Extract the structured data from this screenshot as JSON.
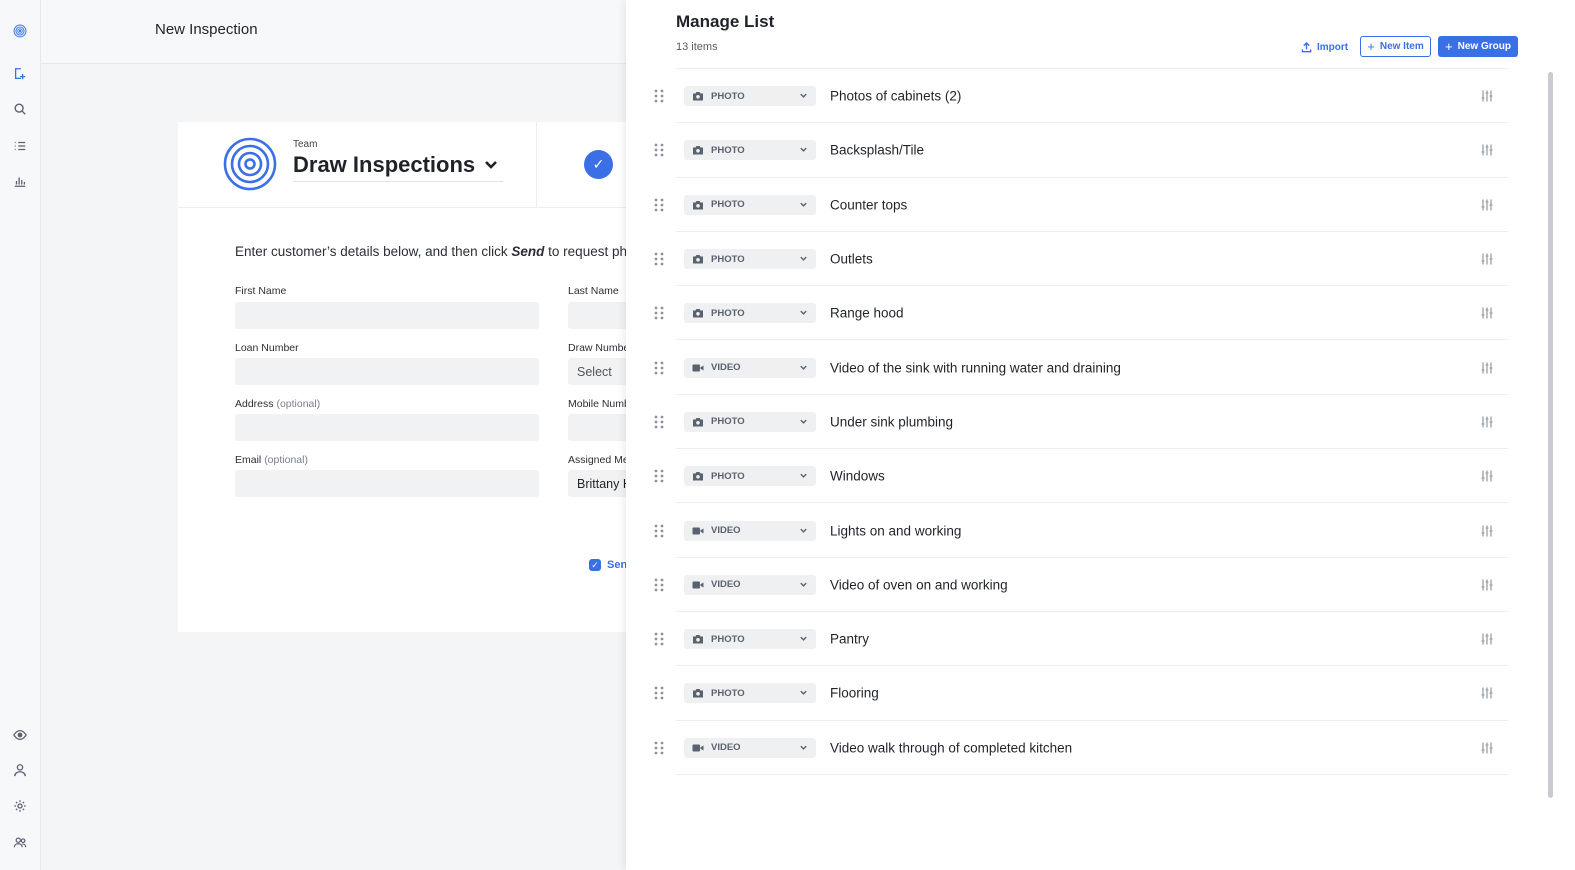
{
  "rail": {
    "icons": [
      "app-logo-icon",
      "new-inspection-icon",
      "search-icon",
      "list-icon",
      "chart-icon",
      "eye-icon",
      "user-icon",
      "gear-icon",
      "team-icon"
    ]
  },
  "page": {
    "title": "New Inspection",
    "team_label": "Team",
    "team_name": "Draw Inspections",
    "intro_prefix": "Enter customer’s details below, and then click ",
    "intro_emphasis": "Send",
    "intro_suffix": " to request pho",
    "fields": {
      "first_name_label": "First Name",
      "last_name_label": "Last Name",
      "loan_number_label": "Loan Number",
      "draw_number_label": "Draw Numbe",
      "draw_number_value": "Select",
      "address_label": "Address",
      "address_optional": "(optional)",
      "mobile_label": "Mobile Numb",
      "email_label": "Email",
      "email_optional": "(optional)",
      "assigned_label": "Assigned Me",
      "assigned_value": "Brittany H"
    },
    "send_label": "Sen"
  },
  "drawer": {
    "title": "Manage List",
    "count": "13 items",
    "import_label": "Import",
    "new_item_label": "New Item",
    "new_group_label": "New Group",
    "items": [
      {
        "type": "PHOTO",
        "label": "Photos of cabinets (2)"
      },
      {
        "type": "PHOTO",
        "label": "Backsplash/Tile"
      },
      {
        "type": "PHOTO",
        "label": "Counter tops"
      },
      {
        "type": "PHOTO",
        "label": "Outlets"
      },
      {
        "type": "PHOTO",
        "label": "Range hood"
      },
      {
        "type": "VIDEO",
        "label": "Video of the sink with running water and draining"
      },
      {
        "type": "PHOTO",
        "label": "Under sink plumbing"
      },
      {
        "type": "PHOTO",
        "label": "Windows"
      },
      {
        "type": "VIDEO",
        "label": "Lights on and working"
      },
      {
        "type": "VIDEO",
        "label": "Video of oven on and working"
      },
      {
        "type": "PHOTO",
        "label": "Pantry"
      },
      {
        "type": "PHOTO",
        "label": "Flooring"
      },
      {
        "type": "VIDEO",
        "label": "Video walk through of completed kitchen"
      }
    ]
  },
  "colors": {
    "accent": "#3b6fe6",
    "text": "#1f2329",
    "muted": "#5a6270"
  }
}
